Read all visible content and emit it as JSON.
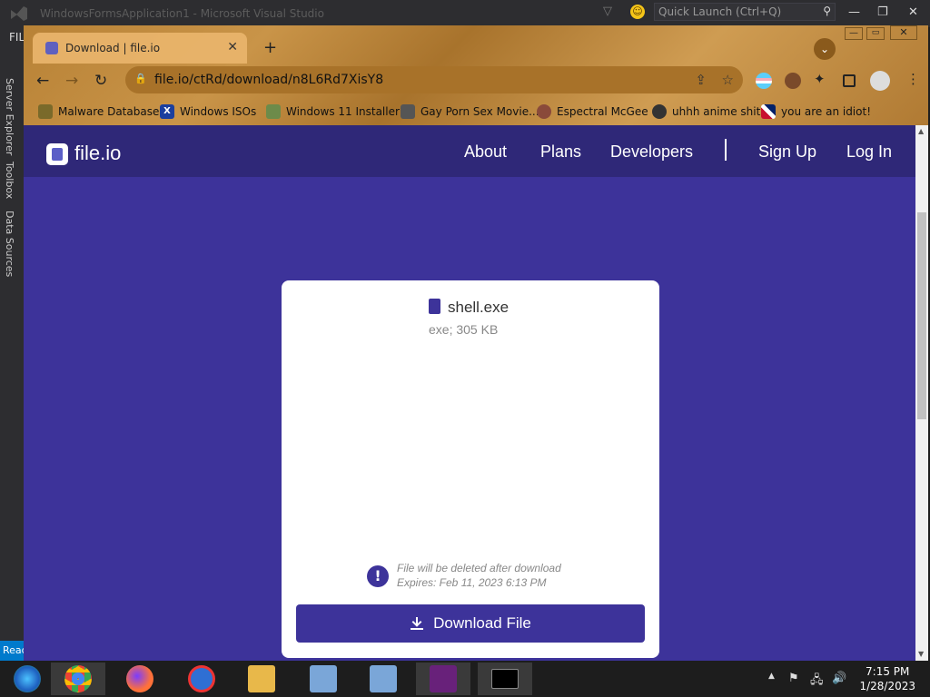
{
  "vs": {
    "title": "WindowsFormsApplication1 - Microsoft Visual Studio",
    "quick_launch_placeholder": "Quick Launch (Ctrl+Q)",
    "file_menu": "FILE",
    "side_tabs": [
      "Server Explorer",
      "Toolbox",
      "Data Sources"
    ],
    "status": "Ready"
  },
  "browser": {
    "tab_title": "Download | file.io",
    "url": "file.io/ctRd/download/n8L6Rd7XisY8",
    "bookmarks": [
      {
        "label": "Malware Database",
        "icon": "bookmark-folder-icon"
      },
      {
        "label": "Windows ISOs",
        "icon": "x-icon"
      },
      {
        "label": "Windows 11 Installer",
        "icon": "image-icon"
      },
      {
        "label": "Gay Porn Sex Movie...",
        "icon": "site-icon"
      },
      {
        "label": "Espectral McGee",
        "icon": "avatar-icon"
      },
      {
        "label": "uhhh anime shit",
        "icon": "anime-icon"
      },
      {
        "label": "you are an idiot!",
        "icon": "flag-icon"
      }
    ]
  },
  "site": {
    "logo_text": "file.io",
    "nav": {
      "about": "About",
      "plans": "Plans",
      "developers": "Developers",
      "signup": "Sign Up",
      "login": "Log In"
    },
    "file": {
      "name": "shell.exe",
      "meta": "exe; 305 KB",
      "delete_notice": "File will be deleted after download",
      "expires": "Expires: Feb 11, 2023 6:13 PM",
      "download_label": "Download File"
    }
  },
  "taskbar": {
    "time": "7:15 PM",
    "date": "1/28/2023"
  },
  "colors": {
    "site_primary": "#3d339a",
    "site_header": "#2f2878",
    "chrome_theme": "#b88236"
  }
}
